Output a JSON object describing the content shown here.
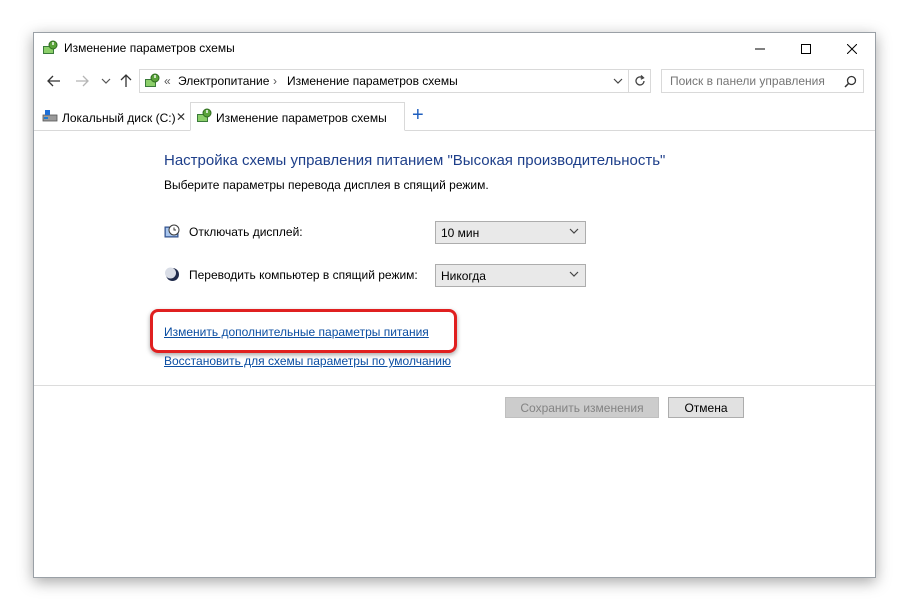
{
  "window": {
    "title": "Изменение параметров схемы"
  },
  "address": {
    "overflow": "«",
    "crumbs": [
      "Электропитание",
      "Изменение параметров схемы"
    ],
    "separator": "›"
  },
  "search": {
    "placeholder": "Поиск в панели управления"
  },
  "tabs": [
    {
      "label": "Локальный диск (C:)",
      "close": "✕"
    },
    {
      "label": "Изменение параметров схемы"
    }
  ],
  "new_tab": "+",
  "content": {
    "heading": "Настройка схемы управления питанием \"Высокая производительность\"",
    "subheading": "Выберите параметры перевода дисплея в спящий режим.",
    "display_off_label": "Отключать дисплей:",
    "display_off_value": "10 мин",
    "sleep_label": "Переводить компьютер в спящий режим:",
    "sleep_value": "Никогда",
    "advanced_link": "Изменить дополнительные параметры питания",
    "restore_link": "Восстановить для схемы параметры по умолчанию"
  },
  "buttons": {
    "save": "Сохранить изменения",
    "cancel": "Отмена"
  },
  "colors": {
    "heading": "#1e3f8a",
    "link": "#0b4ea2",
    "highlight": "#e02020"
  }
}
